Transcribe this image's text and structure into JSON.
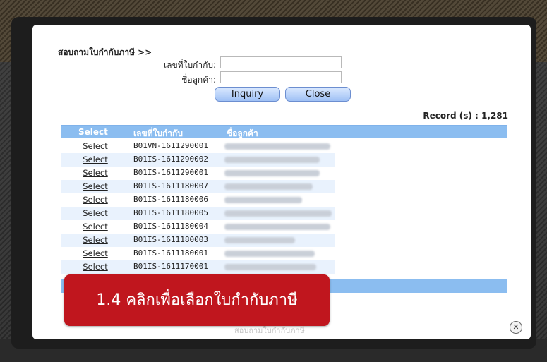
{
  "form": {
    "title": "สอบถามใบกำกับภาษี >>",
    "invoice_no_label": "เลขที่ใบกำกับ:",
    "invoice_no_value": "",
    "customer_label": "ชื่อลูกค้า:",
    "customer_value": "",
    "inquiry_button": "Inquiry",
    "close_button": "Close"
  },
  "record_count": "Record (s) : 1,281",
  "table": {
    "headers": [
      "Select",
      "เลขที่ใบกำกับ",
      "ชื่อลูกค้า"
    ],
    "rows": [
      {
        "select": "Select",
        "invoice": "B01VN-1611290001"
      },
      {
        "select": "Select",
        "invoice": "B01IS-1611290002"
      },
      {
        "select": "Select",
        "invoice": "B01IS-1611290001"
      },
      {
        "select": "Select",
        "invoice": "B01IS-1611180007"
      },
      {
        "select": "Select",
        "invoice": "B01IS-1611180006"
      },
      {
        "select": "Select",
        "invoice": "B01IS-1611180005"
      },
      {
        "select": "Select",
        "invoice": "B01IS-1611180004"
      },
      {
        "select": "Select",
        "invoice": "B01IS-1611180003"
      },
      {
        "select": "Select",
        "invoice": "B01IS-1611180001"
      },
      {
        "select": "Select",
        "invoice": "B01IS-1611170001"
      }
    ]
  },
  "footer_text": "สอบถามใบกำกับภาษี",
  "close_icon": "x-icon",
  "callout": "1.4 คลิกเพื่อเลือกใบกำกับภาษี",
  "colors": {
    "header_bg": "#8bbdf0",
    "row_alt": "#e9f2fd",
    "callout": "#c0161e"
  }
}
